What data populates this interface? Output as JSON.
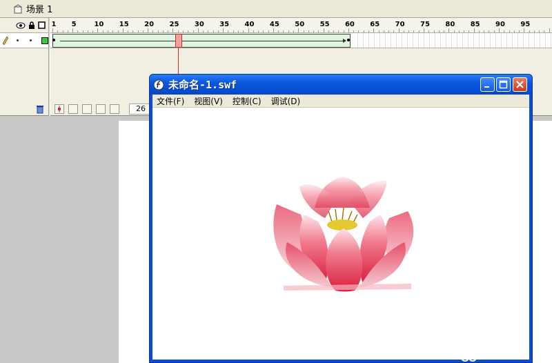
{
  "scene": {
    "label": "场景 1"
  },
  "timeline": {
    "ruler_numbers": [
      "1",
      "5",
      "10",
      "15",
      "20",
      "25",
      "30",
      "35",
      "40",
      "45",
      "50",
      "55",
      "60",
      "65",
      "70",
      "75",
      "80",
      "85",
      "90",
      "95"
    ],
    "current_frame": "26"
  },
  "swf_window": {
    "title": "未命名-1.swf",
    "menu": [
      "文件(F)",
      "视图(V)",
      "控制(C)",
      "调试(D)"
    ]
  },
  "colors": {
    "titlebar": "#0a58e0",
    "tween": "#e0f5e0",
    "playhead": "#f3a0a0",
    "petal": "#e0405a"
  }
}
